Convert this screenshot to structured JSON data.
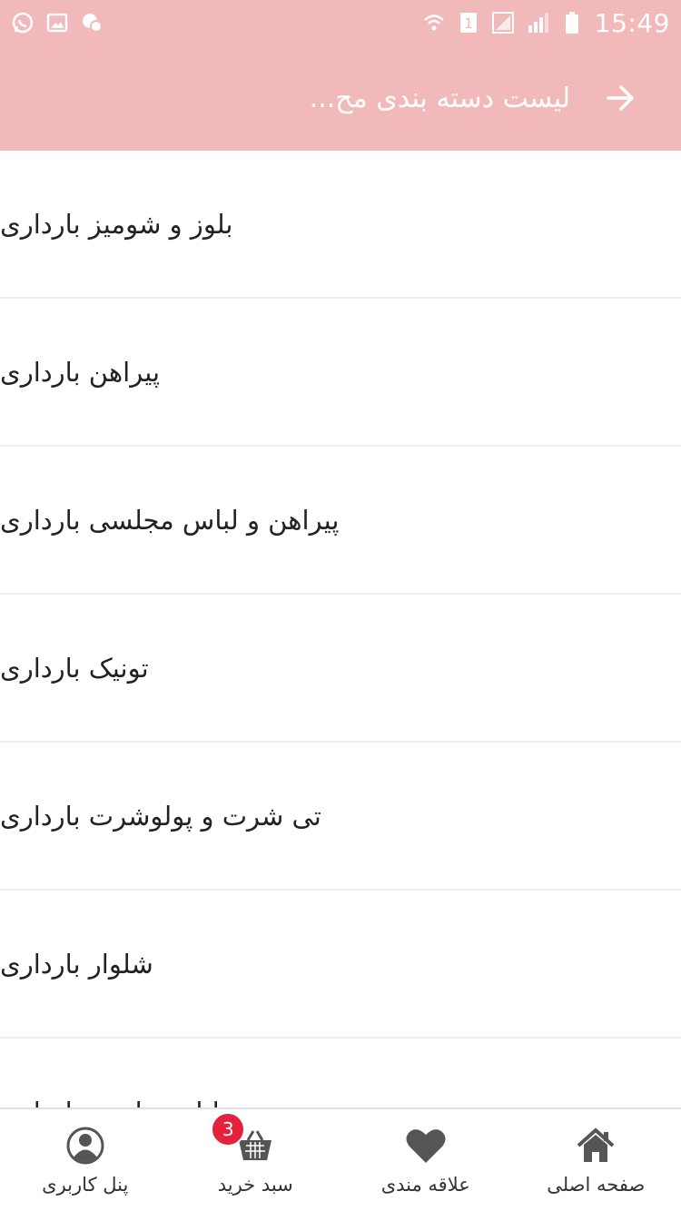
{
  "status_bar": {
    "time": "15:49",
    "left_icons": [
      "whatsapp-icon",
      "gallery-icon",
      "chat-icon"
    ],
    "right_icons": [
      "wifi-icon",
      "sim-icon",
      "signal-icon",
      "signal-icon",
      "battery-icon"
    ]
  },
  "app_bar": {
    "title": "لیست دسته بندی مح...",
    "back_icon": "arrow-right-icon",
    "background_color": "#f1b9ba"
  },
  "categories": [
    {
      "label": "بلوز و شومیز بارداری"
    },
    {
      "label": "پیراهن بارداری"
    },
    {
      "label": "پیراهن و لباس مجلسی بارداری"
    },
    {
      "label": "تونیک بارداری"
    },
    {
      "label": "تی شرت و پولوشرت بارداری"
    },
    {
      "label": "شلوار بارداری"
    },
    {
      "label": "لباس راحتی بارداری"
    }
  ],
  "bottom_nav": {
    "items": [
      {
        "label": "پنل کاربری",
        "icon": "user-icon"
      },
      {
        "label": "سبد خرید",
        "icon": "basket-icon",
        "badge": "3"
      },
      {
        "label": "علاقه مندی",
        "icon": "heart-icon"
      },
      {
        "label": "صفحه اصلی",
        "icon": "home-icon"
      }
    ],
    "badge_color": "#e5213b"
  }
}
